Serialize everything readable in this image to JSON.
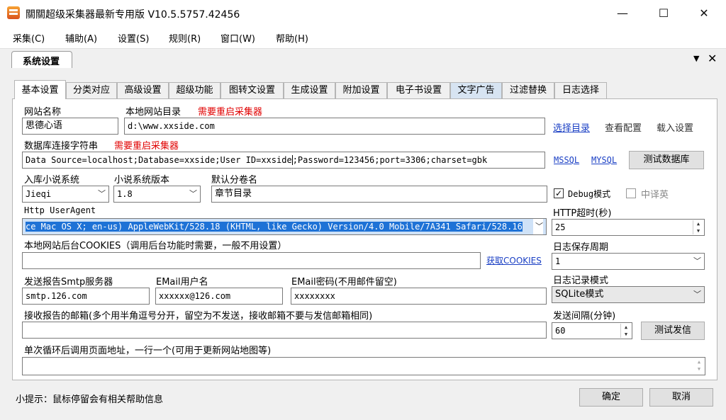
{
  "window": {
    "title": "關關超级采集器最新专用版 V10.5.5757.42456",
    "minimize": "—",
    "maximize": "☐",
    "close": "✕"
  },
  "menu": [
    "采集(C)",
    "辅助(A)",
    "设置(S)",
    "规则(R)",
    "窗口(W)",
    "帮助(H)"
  ],
  "doc_tab": {
    "label": "系统设置",
    "menu_arrow": "▼",
    "close": "✕"
  },
  "tabs": [
    "基本设置",
    "分类对应",
    "高级设置",
    "超级功能",
    "图转文设置",
    "生成设置",
    "附加设置",
    "电子书设置",
    "文字广告",
    "过滤替换",
    "日志选择"
  ],
  "active_tab": "基本设置",
  "site": {
    "name_label": "网站名称",
    "name_value": "思德心语",
    "dir_label": "本地网站目录",
    "restart_note": "需要重启采集器",
    "dir_value": "d:\\www.xxside.com",
    "select_dir": "选择目录",
    "view_config": "查看配置",
    "load_settings": "载入设置"
  },
  "db": {
    "label": "数据库连接字符串",
    "restart_note": "需要重启采集器",
    "value_before": "Data Source=localhost;Database=xxside;User ID=xxside",
    "value_after": ";Password=123456;port=3306;charset=gbk",
    "mssql": "MSSQL",
    "mysql": "MYSQL",
    "test_button": "测试数据库"
  },
  "novel": {
    "system_label": "入库小说系统",
    "system_value": "Jieqi",
    "version_label": "小说系统版本",
    "version_value": "1.8",
    "volume_label": "默认分卷名",
    "volume_value": "章节目录",
    "debug_label": "Debug模式",
    "debug_checked": true,
    "cn_label": "中译英",
    "cn_checked": false
  },
  "http": {
    "ua_label": "Http UserAgent",
    "ua_value": "ce Mac OS X; en-us) AppleWebKit/528.18 (KHTML, like Gecko) Version/4.0 Mobile/7A341 Safari/528.16",
    "timeout_label": "HTTP超时(秒)",
    "timeout_value": "25"
  },
  "cookies": {
    "label": "本地网站后台COOKIES（调用后台功能时需要，一般不用设置）",
    "value": "",
    "get_link": "获取COOKIES"
  },
  "log": {
    "period_label": "日志保存周期",
    "period_value": "1",
    "mode_label": "日志记录模式",
    "mode_value": "SQLite模式"
  },
  "smtp": {
    "server_label": "发送报告Smtp服务器",
    "server_value": "smtp.126.com",
    "user_label": "EMail用户名",
    "user_value": "xxxxxx@126.com",
    "pass_label": "EMail密码(不用邮件留空)",
    "pass_value": "xxxxxxxx"
  },
  "mail": {
    "receivers_label": "接收报告的邮箱(多个用半角逗号分开，留空为不发送，接收邮箱不要与发信邮箱相同)",
    "receivers_value": "",
    "interval_label": "发送间隔(分钟)",
    "interval_value": "60",
    "test_button": "测试发信"
  },
  "loop": {
    "label": "单次循环后调用页面地址，一行一个(可用于更新网站地图等)",
    "value": ""
  },
  "footer": {
    "hint": "小提示：鼠标停留会有相关帮助信息",
    "ok": "确定",
    "cancel": "取消"
  }
}
